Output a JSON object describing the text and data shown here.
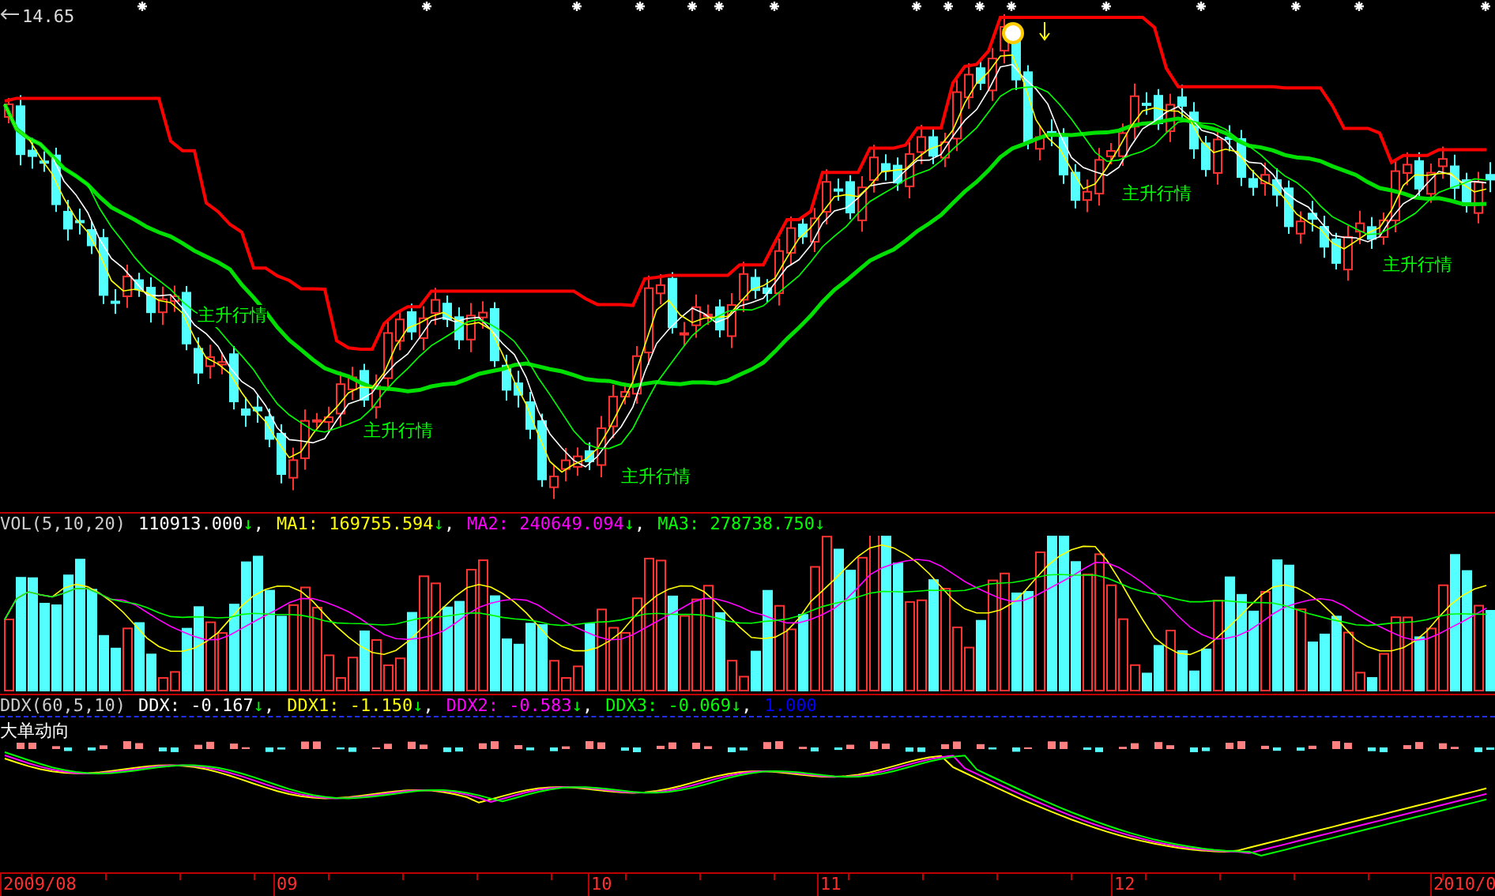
{
  "price_panel": {
    "price_label": "14.65",
    "annotations": [
      "主升行情",
      "主升行情",
      "主升行情",
      "主升行情",
      "主升行情"
    ]
  },
  "volume_panel": {
    "title": "VOL(5,10,20)",
    "readings": [
      {
        "text": "110913.000",
        "arrow": "↓",
        "separator": ",",
        "color": "#ffffff"
      },
      {
        "text": "MA1: 169755.594",
        "arrow": "↓",
        "separator": ",",
        "color": "#ffff00"
      },
      {
        "text": "MA2: 240649.094",
        "arrow": "↓",
        "separator": ",",
        "color": "#ff00ff"
      },
      {
        "text": "MA3: 278738.750",
        "arrow": "↓",
        "color": "#00ff00"
      }
    ]
  },
  "ddx_panel": {
    "title": "DDX(60,5,10)",
    "subtitle": "大单动向",
    "readings": [
      {
        "text": "DDX: -0.167",
        "arrow": "↓",
        "separator": ",",
        "color": "#ffffff"
      },
      {
        "text": "DDX1: -1.150",
        "arrow": "↓",
        "separator": ",",
        "color": "#ffff00"
      },
      {
        "text": "DDX2: -0.583",
        "arrow": "↓",
        "separator": ",",
        "color": "#ff00ff"
      },
      {
        "text": "DDX3: -0.069",
        "arrow": "↓",
        "separator": ",",
        "color": "#00ff00"
      },
      {
        "text": "1.000",
        "color": "#0000ff"
      }
    ]
  },
  "x_axis": {
    "labels": [
      "2009/08",
      "09",
      "10",
      "11",
      "12",
      "2010/0"
    ]
  }
}
